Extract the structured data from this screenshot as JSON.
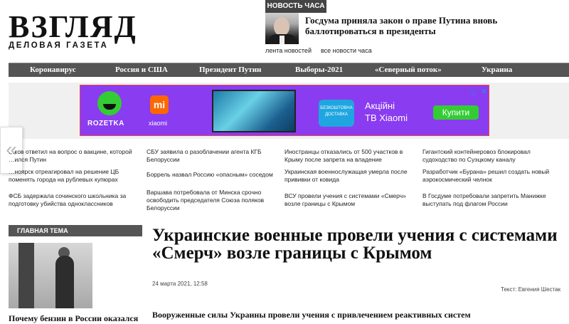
{
  "logo": {
    "main": "ВЗГЛЯД",
    "sub": "ДЕЛОВАЯ ГАЗЕТА"
  },
  "news_hour": {
    "label": "НОВОСТЬ ЧАСА",
    "title": "Госдума приняла закон о праве Путина вновь баллотироваться в президенты",
    "link_feed": "лента новостей",
    "link_all": "все новости часа"
  },
  "nav": {
    "items": [
      "Коронавирус",
      "Россия и США",
      "Президент Путин",
      "Выборы-2021",
      "«Северный поток»",
      "Украина"
    ]
  },
  "ad": {
    "brand": "ROZETKA",
    "partner": "xiaomi",
    "mi_logo": "mi",
    "delivery": "БЕЗКОШТОВНА ДОСТАВКА",
    "text_line1": "Акційні",
    "text_line2": "ТВ Xiaomi",
    "button": "Купити"
  },
  "left_arrow": "«",
  "news_grid": {
    "col1": [
      "…ков ответил на вопрос о вакцине, которой …ился Путин",
      "…ноярск отреагировал на решение ЦБ поменять города на рублевых купюрах",
      "ФСБ задержала сочинского школьника за подготовку убийства одноклассников"
    ],
    "col2": [
      "СБУ заявила о разоблачении агента КГБ Белоруссии",
      "Боррель назвал Россию «опасным» соседом",
      "Варшава потребовала от Минска срочно освободить председателя Союза поляков Белоруссии"
    ],
    "col3": [
      "Иностранцы отказались от 500 участков в Крыму после запрета на владение",
      "Украинская военнослужащая умерла после прививки от ковида",
      "ВСУ провели учения с системами «Смерч» возле границы с Крымом"
    ],
    "col4": [
      "Гигантский контейнеровоз блокировал судоходство по Суэцкому каналу",
      "Разработчик «Бурана» решил создать новый аэрокосмический челнок",
      "В Госдуме потребовали запретить Манижке выступать под флагом России"
    ]
  },
  "main_theme": {
    "label": "ГЛАВНАЯ ТЕМА",
    "caption": "Почему бензин в России оказался"
  },
  "article": {
    "title": "Украинские военные провели учения с системами «Смерч» возле границы с Крымом",
    "date": "24 марта 2021, 12:58",
    "author": "Текст: Евгения Шестак",
    "lead": "Вооруженные силы Украины провели учения с привлечением реактивных систем"
  }
}
